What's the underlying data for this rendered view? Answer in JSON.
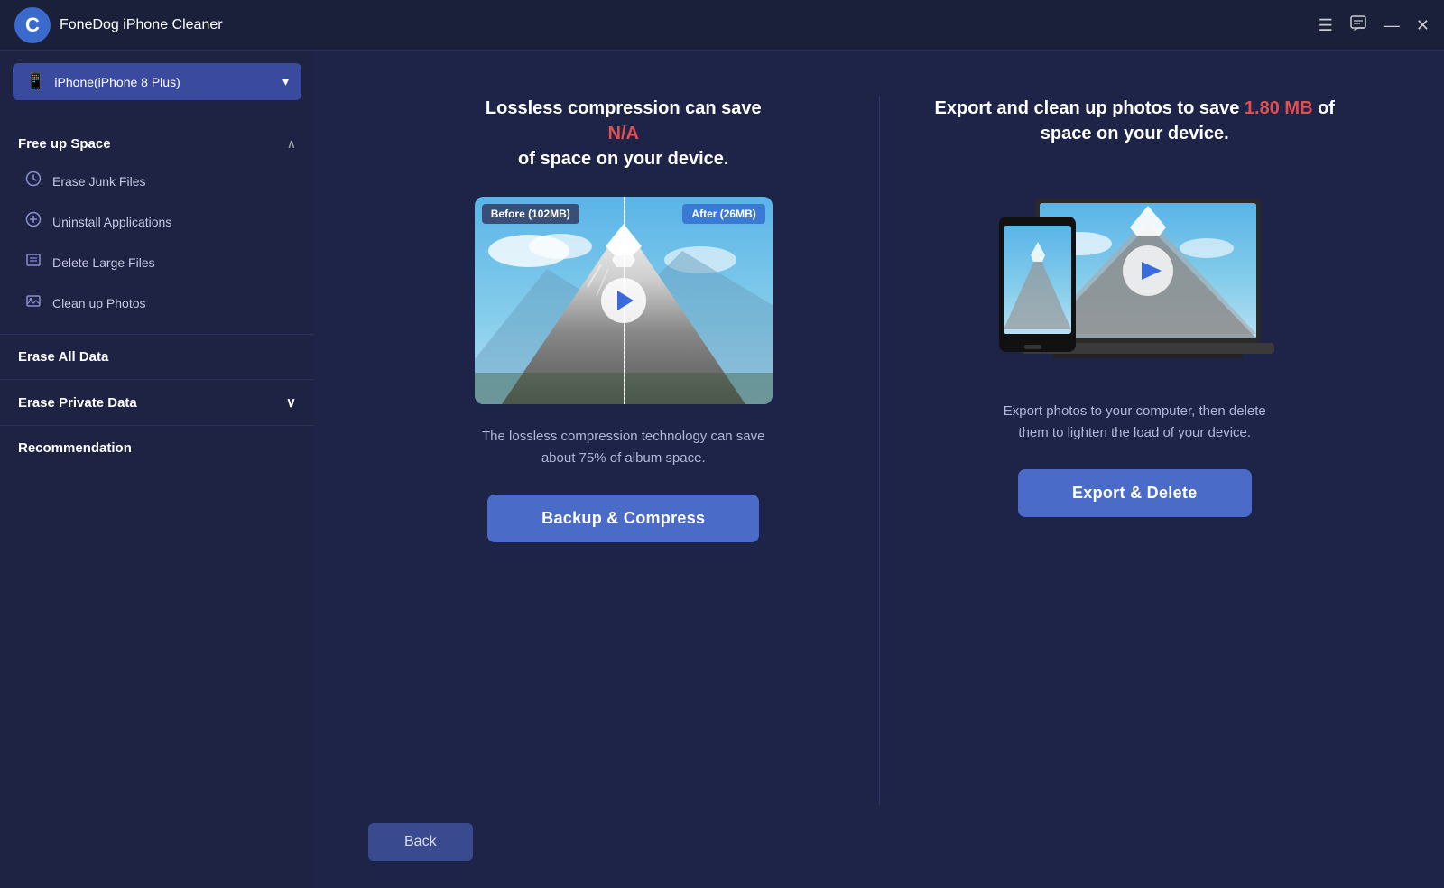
{
  "app": {
    "title": "FoneDog iPhone Cleaner",
    "logo_letter": "C"
  },
  "titlebar": {
    "menu_icon": "☰",
    "chat_icon": "💬",
    "minimize_icon": "—",
    "close_icon": "✕"
  },
  "device": {
    "name": "iPhone(iPhone 8 Plus)"
  },
  "sidebar": {
    "free_up_space": {
      "title": "Free up Space",
      "items": [
        {
          "label": "Erase Junk Files",
          "icon": "🕐"
        },
        {
          "label": "Uninstall Applications",
          "icon": "⊗"
        },
        {
          "label": "Delete Large Files",
          "icon": "▤"
        },
        {
          "label": "Clean up Photos",
          "icon": "🖼"
        }
      ]
    },
    "erase_all_data": {
      "title": "Erase All Data"
    },
    "erase_private_data": {
      "title": "Erase Private Data"
    },
    "recommendation": {
      "title": "Recommendation"
    }
  },
  "left_panel": {
    "title_part1": "Lossless compression can save",
    "title_highlight": "N/A",
    "title_part2": "of space on your device.",
    "before_label": "Before (102MB)",
    "after_label": "After (26MB)",
    "description": "The lossless compression technology can save about 75% of album space.",
    "button_label": "Backup & Compress"
  },
  "right_panel": {
    "title_part1": "Export and clean up photos to save",
    "title_highlight": "1.80 MB",
    "title_part2": "of space on your device.",
    "description": "Export photos to your computer, then delete them to lighten the load of your device.",
    "button_label": "Export & Delete"
  },
  "bottom": {
    "back_label": "Back"
  }
}
